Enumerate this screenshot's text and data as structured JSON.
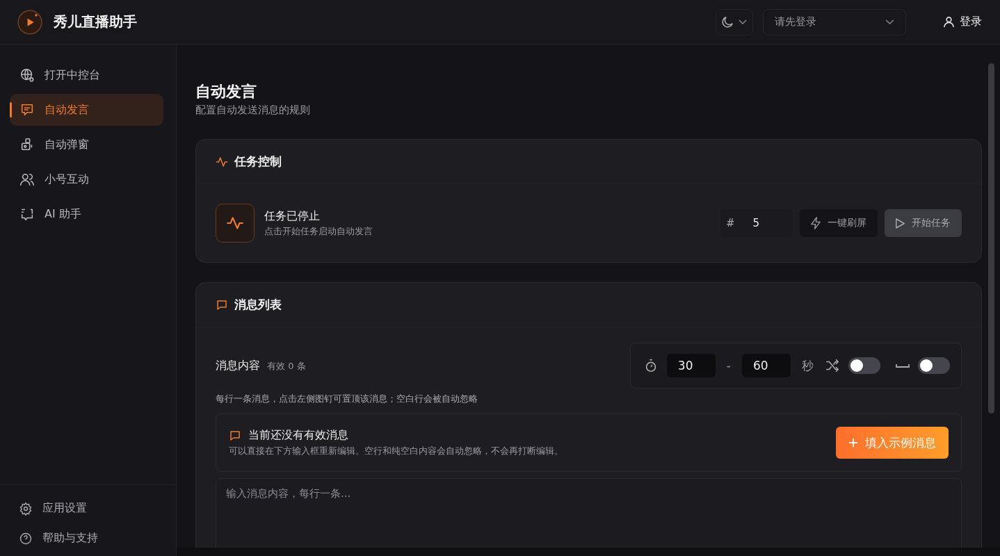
{
  "app": {
    "title": "秀儿直播助手"
  },
  "header": {
    "theme_toggle": {
      "kind": "dark"
    },
    "account_select": {
      "placeholder": "请先登录"
    },
    "login_button": "登录"
  },
  "sidebar": {
    "items": [
      {
        "label": "打开中控台",
        "selected": false
      },
      {
        "label": "自动发言",
        "selected": true
      },
      {
        "label": "自动弹窗",
        "selected": false
      },
      {
        "label": "小号互动",
        "selected": false
      },
      {
        "label": "AI 助手",
        "selected": false
      }
    ],
    "footer_items": [
      {
        "label": "应用设置"
      },
      {
        "label": "帮助与支持"
      }
    ]
  },
  "page": {
    "title": "自动发言",
    "subtitle": "配置自动发送消息的规则"
  },
  "task_card": {
    "title": "任务控制",
    "status_title": "任务已停止",
    "status_desc": "点击开始任务启动自动发言",
    "count_prefix": "#",
    "count_value": "5",
    "refresh_button": "一键刷屏",
    "start_button": {
      "label": "开始任务",
      "disabled": true
    }
  },
  "message_card": {
    "title": "消息列表",
    "content_label": "消息内容",
    "valid_count": "有效 0 条",
    "interval": {
      "min": "30",
      "separator": "-",
      "max": "60",
      "unit": "秒"
    },
    "toggles": [
      {
        "kind": "shuffle",
        "on": false
      },
      {
        "kind": "space",
        "on": false
      }
    ],
    "hint": "每行一条消息，点击左侧图钉可置顶该消息；空白行会被自动忽略",
    "empty_notice": {
      "title": "当前还没有有效消息",
      "desc": "可以直接在下方输入框重新编辑。空行和纯空白内容会自动忽略，不会再打断编辑。",
      "button": "填入示例消息"
    },
    "editor": {
      "placeholder": "输入消息内容，每行一条..."
    }
  }
}
